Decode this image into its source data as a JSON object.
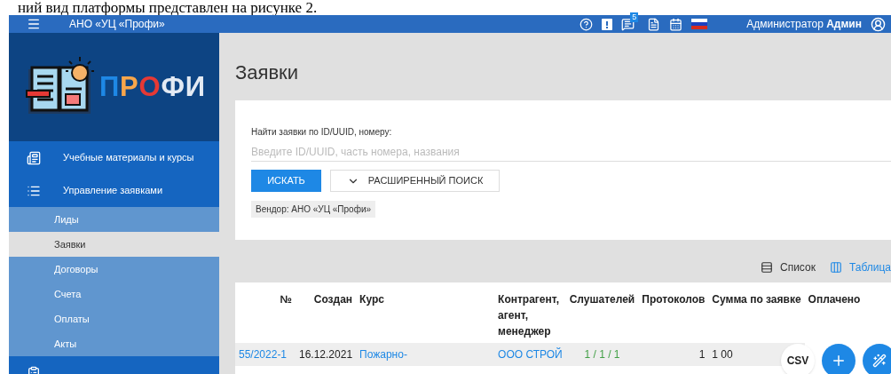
{
  "document_text": "ний вид платформы представлен на рисунке 2.",
  "topbar": {
    "org": "АНО «УЦ «Профи»",
    "messages_badge": "5",
    "role": "Администратор",
    "user": "Админ"
  },
  "logo": {
    "text": "ПРОФИ"
  },
  "sidebar": {
    "items": [
      {
        "label": "Учебные материалы и курсы"
      },
      {
        "label": "Управление заявками",
        "children": [
          {
            "label": "Лиды",
            "selected": false
          },
          {
            "label": "Заявки",
            "selected": true
          },
          {
            "label": "Договоры",
            "selected": false
          },
          {
            "label": "Счета",
            "selected": false
          },
          {
            "label": "Оплаты",
            "selected": false
          },
          {
            "label": "Акты",
            "selected": false
          }
        ]
      }
    ]
  },
  "page": {
    "title": "Заявки"
  },
  "search": {
    "label": "Найти заявки по ID/UUID, номеру:",
    "placeholder": "Введите ID/UUID, часть номера, названия",
    "search_button": "ИСКАТЬ",
    "advanced_button": "РАСШИРЕННЫЙ ПОИСК",
    "filter_chip": "Вендор: АНО «УЦ «Профи»"
  },
  "view_toggle": [
    {
      "label": "Список",
      "selected": false
    },
    {
      "label": "Таблица",
      "selected": true
    }
  ],
  "table": {
    "columns": [
      "№",
      "Создан",
      "Курс",
      "Контрагент, агент, менеджер",
      "Слушателей",
      "Протоколов",
      "Сумма по заявке",
      "Оплачено"
    ],
    "rows": [
      [
        "55/2022-1",
        "16.12.2021",
        "Пожарно-",
        "ООО СТРОЙ",
        "1 / 1 / 1",
        "1",
        "1 00"
      ]
    ]
  },
  "fab": {
    "csv": "CSV"
  }
}
